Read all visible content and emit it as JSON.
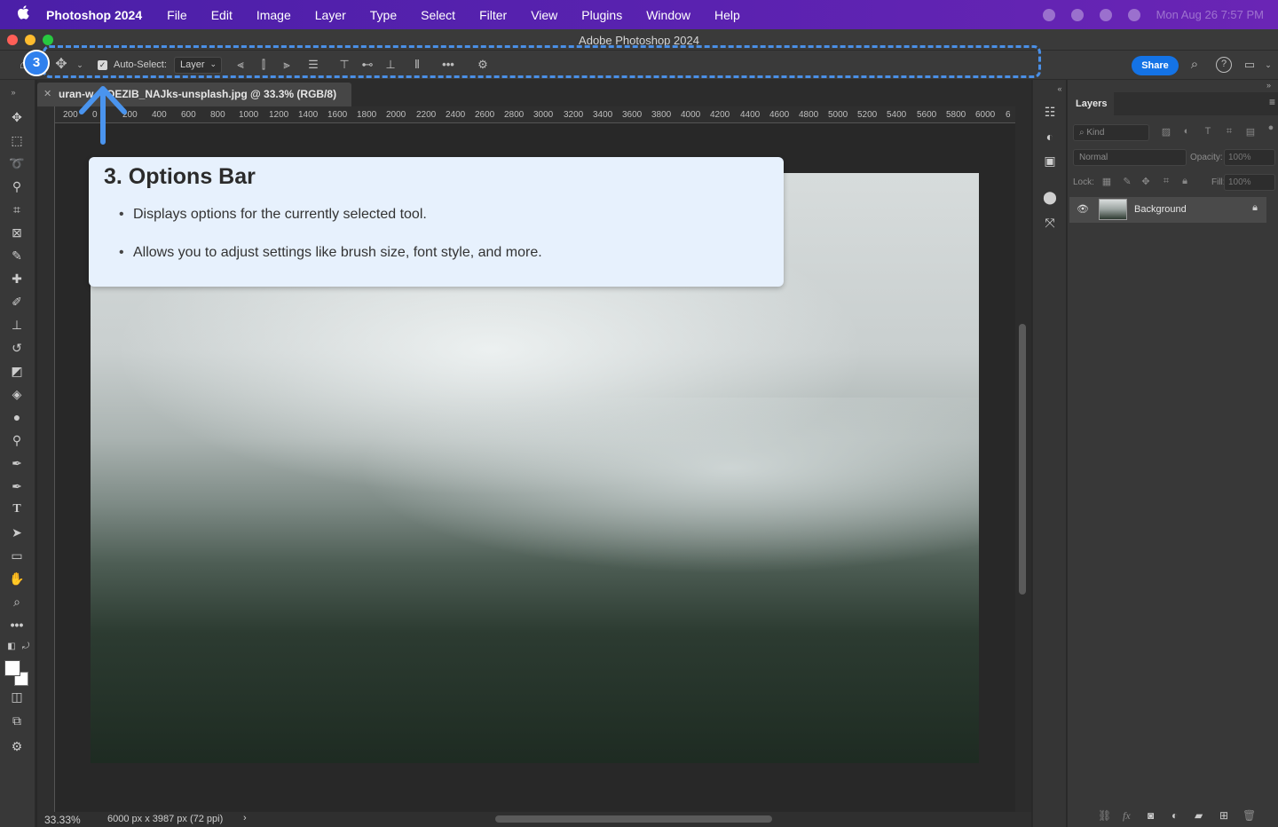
{
  "menubar": {
    "apple": "",
    "app_name": "Photoshop 2024",
    "items": [
      "File",
      "Edit",
      "Image",
      "Layer",
      "Type",
      "Select",
      "Filter",
      "View",
      "Plugins",
      "Window",
      "Help"
    ],
    "clock": "Mon Aug 26  7:57 PM"
  },
  "window": {
    "title": "Adobe Photoshop 2024"
  },
  "options_bar": {
    "auto_select_label": "Auto-Select:",
    "auto_select_checked": "✓",
    "layer_select_value": "Layer",
    "share_label": "Share"
  },
  "annotation": {
    "step_number": "3",
    "title": "3. Options Bar",
    "bullets": [
      "Displays options for the currently selected tool.",
      "Allows you to adjust settings like brush size, font style, and more."
    ]
  },
  "document": {
    "tab_title": "uran-w     n-QEZIB_NAJks-unsplash.jpg @ 33.3% (RGB/8)",
    "ruler_ticks": [
      "200",
      "0",
      "200",
      "400",
      "600",
      "800",
      "1000",
      "1200",
      "1400",
      "1600",
      "1800",
      "2000",
      "2200",
      "2400",
      "2600",
      "2800",
      "3000",
      "3200",
      "3400",
      "3600",
      "3800",
      "4000",
      "4200",
      "4400",
      "4600",
      "4800",
      "5000",
      "5200",
      "5400",
      "5600",
      "5800",
      "6000",
      "6"
    ]
  },
  "status_bar": {
    "zoom": "33.33%",
    "dimensions": "6000 px x 3987 px (72 ppi)",
    "arrow": "›"
  },
  "layers_panel": {
    "tab_label": "Layers",
    "kind_placeholder": "Kind",
    "blend_mode": "Normal",
    "opacity_label": "Opacity:",
    "opacity_value": "100%",
    "lock_label": "Lock:",
    "fill_label": "Fill:",
    "fill_value": "100%",
    "layers": [
      {
        "name": "Background"
      }
    ]
  },
  "colors": {
    "menubar": "#5a22b0",
    "highlight": "#4a8fe6",
    "share": "#1473e6",
    "callout_bg": "#e7f1fd"
  }
}
